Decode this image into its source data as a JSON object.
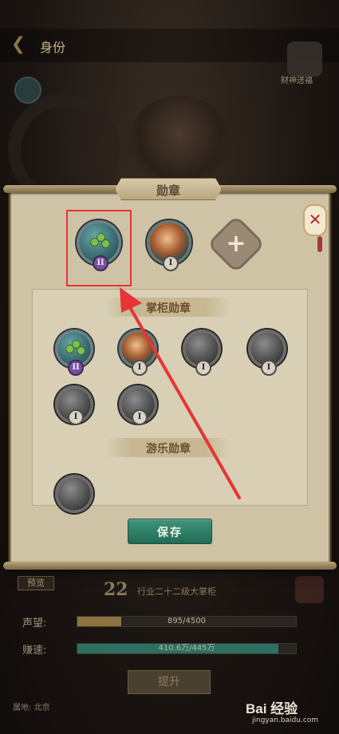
{
  "background": {
    "title": "身份",
    "god_label": "财神送福",
    "preview_label": "预览",
    "level_number": "22",
    "level_title": "行业二十二级大掌柜",
    "stats": [
      {
        "label": "声望:",
        "value": "895/4500",
        "progress": 0.2
      },
      {
        "label": "赚速:",
        "value": "410.6万/445万",
        "progress": 0.92
      }
    ],
    "upgrade_label": "提升",
    "origin_text": "属地: 北京"
  },
  "modal": {
    "title": "勋章",
    "equipped": [
      {
        "icon": "leaf-medal-icon",
        "rank": "II"
      },
      {
        "icon": "hotpot-medal-icon",
        "rank": "I"
      },
      {
        "icon": "add-slot-icon"
      }
    ],
    "sections": [
      {
        "title": "掌柜勋章",
        "badges": [
          {
            "icon": "leaf-medal-icon",
            "rank": "II",
            "owned": true
          },
          {
            "icon": "hotpot-medal-icon",
            "rank": "I",
            "owned": true
          },
          {
            "icon": "roast-meat-medal-icon",
            "rank": "I",
            "owned": false
          },
          {
            "icon": "dragon-medal-icon",
            "rank": "I",
            "owned": false
          },
          {
            "icon": "beetle-medal-icon",
            "rank": "I",
            "owned": false
          },
          {
            "icon": "lady-portrait-medal-icon",
            "rank": "I",
            "owned": false
          }
        ]
      },
      {
        "title": "游乐勋章",
        "badges": [
          {
            "icon": "bug-medal-icon",
            "owned": false
          }
        ]
      }
    ],
    "save_label": "保存"
  },
  "watermark": {
    "brand": "Bai 经验",
    "url": "jingyan.baidu.com"
  },
  "colors": {
    "highlight": "#e53535",
    "save_button": "#2f8266",
    "parchment": "#cfc3a6"
  }
}
